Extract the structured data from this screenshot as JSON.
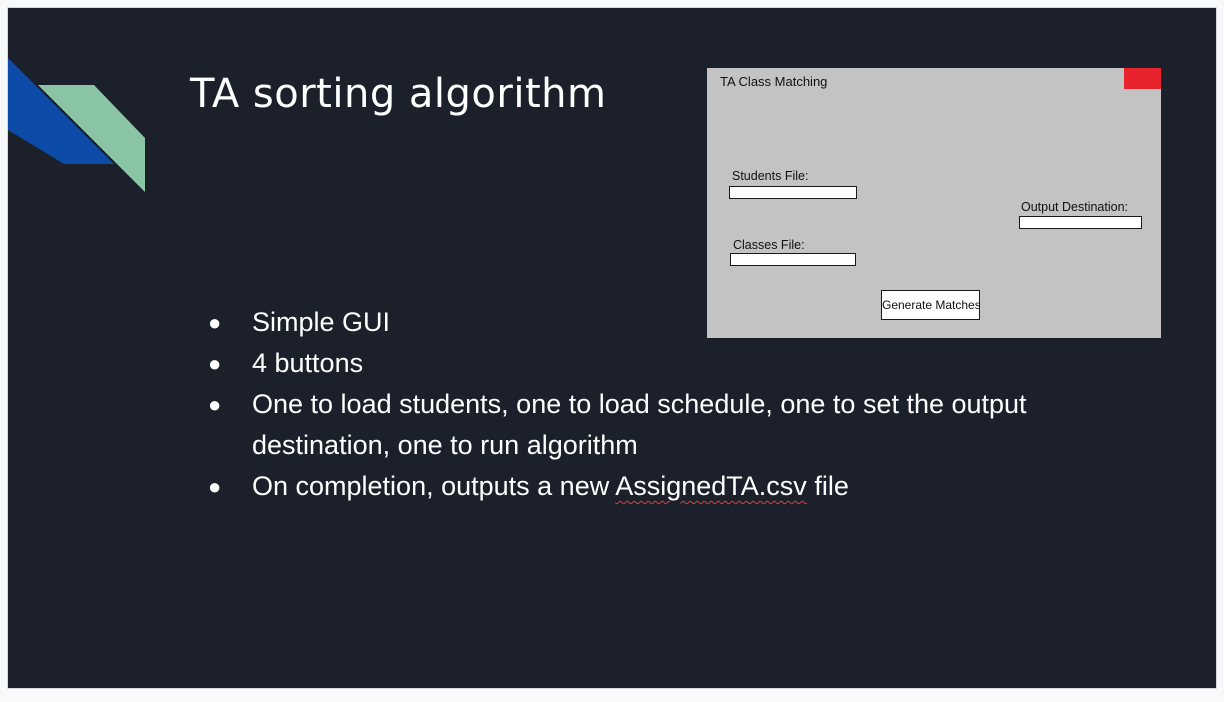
{
  "slide": {
    "title": "TA sorting algorithm",
    "bullets": [
      {
        "text": "Simple GUI"
      },
      {
        "text": "4 buttons"
      },
      {
        "text": "One to load students, one to load schedule, one to set the output destination, one to run algorithm"
      },
      {
        "before": "On completion, outputs a new ",
        "flagged": "AssignedTA.csv",
        "after": " file"
      }
    ],
    "bullet_symbol": "●"
  },
  "app_window": {
    "title": "TA Class Matching",
    "students_label": "Students File:",
    "classes_label": "Classes File:",
    "output_label": "Output Destination:",
    "generate_button": "Generate Matches",
    "students_value": "",
    "classes_value": "",
    "output_value": ""
  },
  "colors": {
    "background": "#1b202b",
    "deco_blue": "#0d4ba8",
    "deco_green": "#8ac6a6",
    "close_red": "#e8232d",
    "window_gray": "#c3c3c3"
  },
  "icons": {
    "decoration": "diagonal-stripes",
    "close": "red-close-block"
  }
}
